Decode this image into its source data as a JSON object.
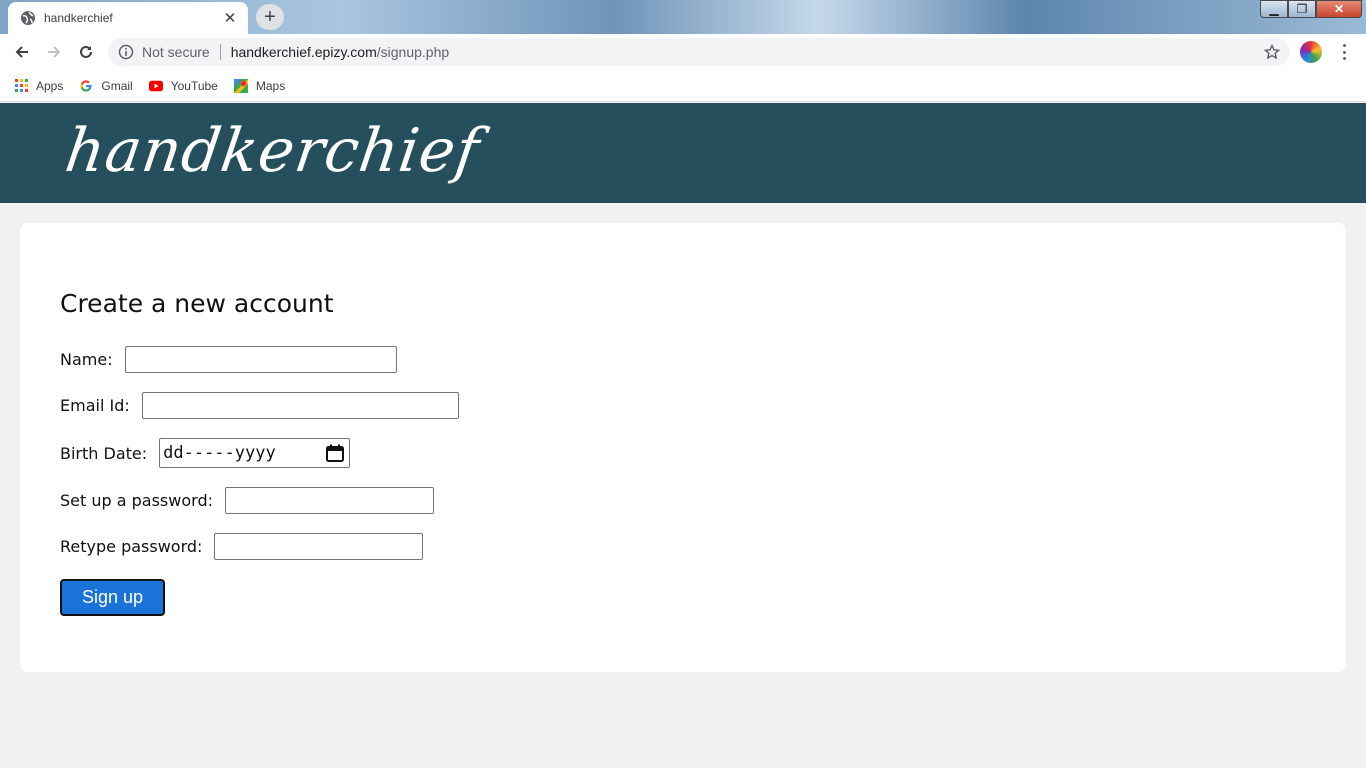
{
  "browser": {
    "tab_title": "handkerchief",
    "tab_close": "✕",
    "new_tab": "+",
    "not_secure": "Not secure",
    "url_host": "handkerchief.epizy.com",
    "url_path": "/signup.php",
    "window_controls": {
      "minimize": "▁",
      "maximize": "❐",
      "close": "✕"
    }
  },
  "bookmarks": [
    {
      "label": "Apps",
      "icon": "apps-grid-icon"
    },
    {
      "label": "Gmail",
      "icon": "google-g-icon"
    },
    {
      "label": "YouTube",
      "icon": "youtube-icon"
    },
    {
      "label": "Maps",
      "icon": "maps-icon"
    }
  ],
  "site": {
    "logo": "handkerchief"
  },
  "form": {
    "title": "Create a new account",
    "name_label": "Name:",
    "email_label": "Email Id:",
    "birth_label": "Birth Date:",
    "birth_placeholder": "dd-----yyyy",
    "password_label": "Set up a password:",
    "retype_label": "Retype password:",
    "submit_label": "Sign up"
  },
  "colors": {
    "header_bg": "#254f5c",
    "button_bg": "#1a73d9",
    "page_bg": "#f1f1f1"
  }
}
